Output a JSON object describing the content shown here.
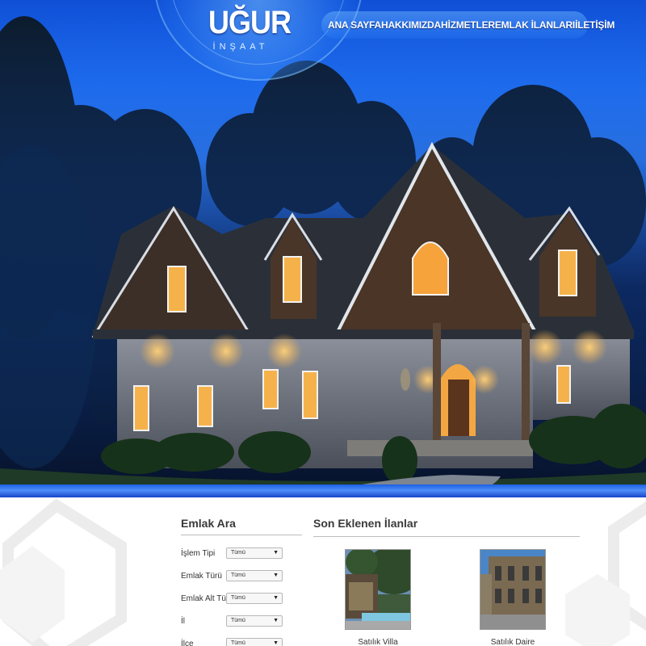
{
  "brand": {
    "name": "UĞUR",
    "tagline": "İNŞAAT"
  },
  "nav": {
    "items": [
      {
        "label": "ANA SAYFA"
      },
      {
        "label": "HAKKIMIZDA"
      },
      {
        "label": "HİZMETLER"
      },
      {
        "label": "EMLAK İLANLARI"
      },
      {
        "label": "İLETİŞİM"
      }
    ]
  },
  "colors": {
    "primary_blue": "#1f6ff2",
    "nav_text": "#ffffff",
    "heading_text": "#3a3a3a"
  },
  "search": {
    "title": "Emlak Ara",
    "fields": [
      {
        "label": "İşlem Tipi",
        "value": "Tümü"
      },
      {
        "label": "Emlak Türü",
        "value": "Tümü"
      },
      {
        "label": "Emlak Alt Türü",
        "value": "Tümü"
      },
      {
        "label": "İl",
        "value": "Tümü"
      },
      {
        "label": "İlçe",
        "value": "Tümü"
      }
    ]
  },
  "recent": {
    "title": "Son Eklenen İlanlar",
    "listings": [
      {
        "caption": "Satılık Villa"
      },
      {
        "caption": "Satılık Daire"
      }
    ]
  }
}
